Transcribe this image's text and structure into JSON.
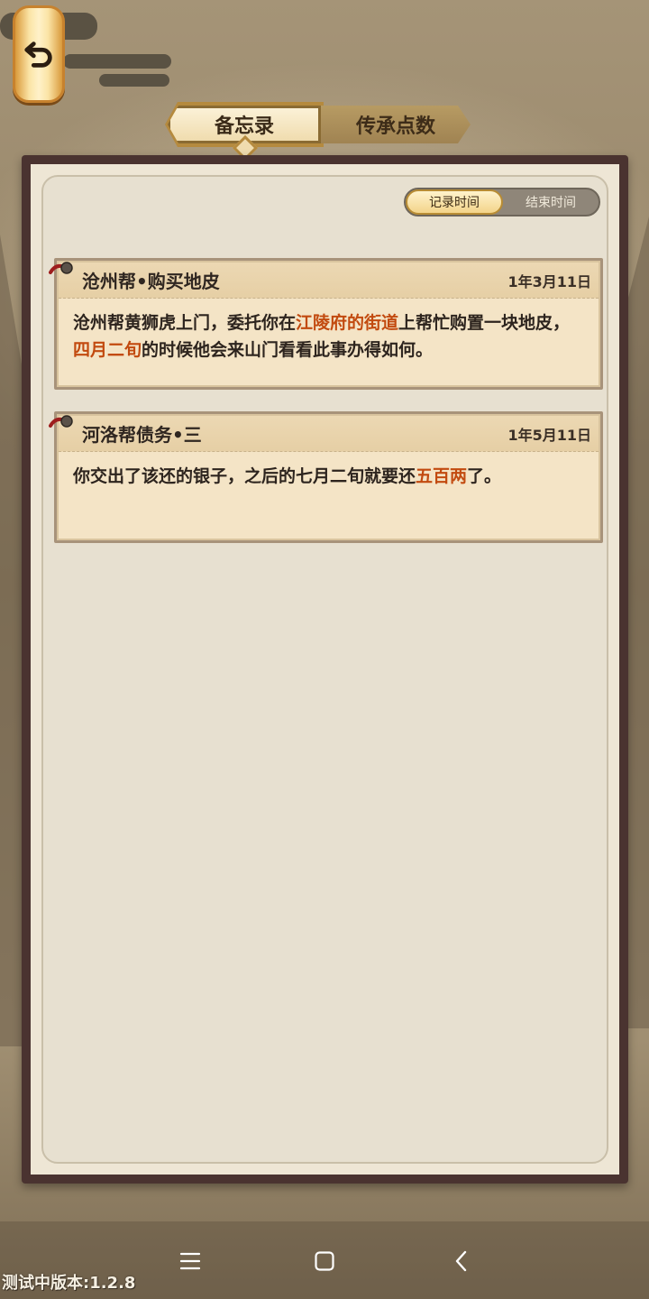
{
  "tabs": [
    {
      "label": "备忘录",
      "active": true
    },
    {
      "label": "传承点数",
      "active": false
    }
  ],
  "sort": {
    "options": [
      "记录时间",
      "结束时间"
    ],
    "selected": "记录时间"
  },
  "memos": [
    {
      "title": "沧州帮•购买地皮",
      "date": "1年3月11日",
      "text_parts": [
        "沧州帮黄狮虎上门，委托你在",
        "江陵府的街道",
        "上帮忙购置一块地皮，",
        "四月二旬",
        "的时候他会来山门看看此事办得如何。"
      ]
    },
    {
      "title": "河洛帮债务•三",
      "date": "1年5月11日",
      "text_parts": [
        "你交出了该还的银子，之后的七月二旬就要还",
        "五百两",
        "了。"
      ]
    }
  ],
  "version_text": "测试中版本:1.2.8",
  "icons": {
    "back": "back-arrow-icon",
    "nav_menu": "menu-icon",
    "nav_home": "home-square-icon",
    "nav_back": "chevron-left-icon"
  },
  "colors": {
    "highlight": "#c24a0f",
    "panel_border": "#4a3330",
    "card_bg": "#f4e4c6"
  }
}
